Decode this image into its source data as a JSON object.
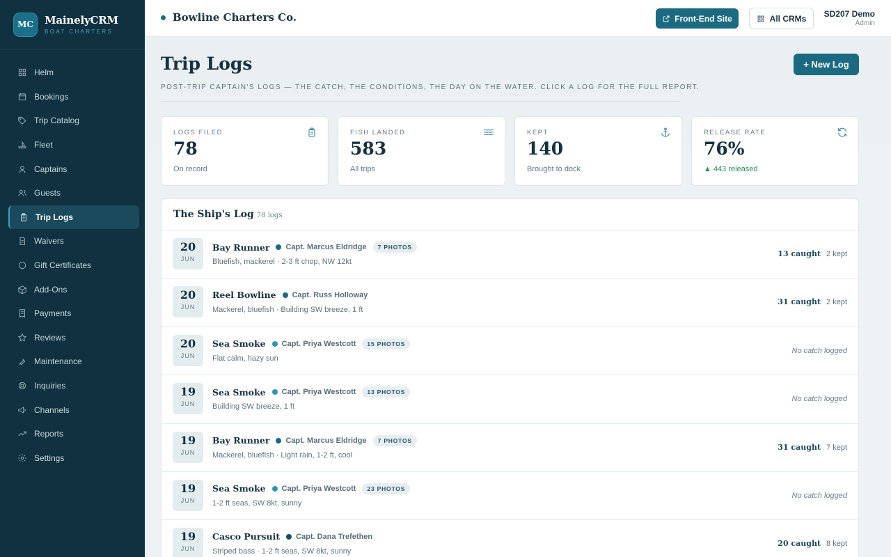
{
  "brand": {
    "initials": "MC",
    "name": "MainelyCRM",
    "subtitle": "BOAT CHARTERS"
  },
  "sidebar": {
    "items": [
      {
        "label": "Helm",
        "icon": "grid-icon",
        "active": false
      },
      {
        "label": "Bookings",
        "icon": "calendar-icon",
        "active": false
      },
      {
        "label": "Trip Catalog",
        "icon": "tag-icon",
        "active": false
      },
      {
        "label": "Fleet",
        "icon": "boat-icon",
        "active": false
      },
      {
        "label": "Captains",
        "icon": "captain-icon",
        "active": false
      },
      {
        "label": "Guests",
        "icon": "users-icon",
        "active": false
      },
      {
        "label": "Trip Logs",
        "icon": "clipboard-icon",
        "active": true
      },
      {
        "label": "Waivers",
        "icon": "document-icon",
        "active": false
      },
      {
        "label": "Gift Certificates",
        "icon": "circle-icon",
        "active": false
      },
      {
        "label": "Add-Ons",
        "icon": "box-icon",
        "active": false
      },
      {
        "label": "Payments",
        "icon": "receipt-icon",
        "active": false
      },
      {
        "label": "Reviews",
        "icon": "star-icon",
        "active": false
      },
      {
        "label": "Maintenance",
        "icon": "wrench-icon",
        "active": false
      },
      {
        "label": "Inquiries",
        "icon": "lifebuoy-icon",
        "active": false
      },
      {
        "label": "Channels",
        "icon": "megaphone-icon",
        "active": false
      },
      {
        "label": "Reports",
        "icon": "trend-icon",
        "active": false
      },
      {
        "label": "Settings",
        "icon": "gear-icon",
        "active": false
      }
    ]
  },
  "topbar": {
    "company": "Bowline Charters Co.",
    "front_end_label": "Front-End Site",
    "all_crms_label": "All CRMs",
    "user_name": "SD207 Demo",
    "user_role": "Admin"
  },
  "page": {
    "title": "Trip Logs",
    "subtitle": "POST-TRIP CAPTAIN'S LOGS — THE CATCH, THE CONDITIONS, THE DAY ON THE WATER. CLICK A LOG FOR THE FULL REPORT.",
    "new_log_label": "+ New Log"
  },
  "stats": [
    {
      "label": "LOGS FILED",
      "value": "78",
      "sub": "On record",
      "icon": "clipboard-icon",
      "green": false
    },
    {
      "label": "FISH LANDED",
      "value": "583",
      "sub": "All trips",
      "icon": "waves-icon",
      "green": false
    },
    {
      "label": "KEPT",
      "value": "140",
      "sub": "Brought to dock",
      "icon": "anchor-icon",
      "green": false
    },
    {
      "label": "RELEASE RATE",
      "value": "76%",
      "sub": "▲ 443 released",
      "icon": "refresh-icon",
      "green": true
    }
  ],
  "log": {
    "title": "The Ship's Log",
    "count": "78 logs",
    "rows": [
      {
        "day": "20",
        "month": "JUN",
        "boat": "Bay Runner",
        "captain": "Capt. Marcus Eldridge",
        "captain_color": "#1b6a82",
        "photos": "7 PHOTOS",
        "conditions": "Bluefish, mackerel · 2-3 ft chop, NW 12kt",
        "caught": "13 caught",
        "kept": "2 kept",
        "no_catch": ""
      },
      {
        "day": "20",
        "month": "JUN",
        "boat": "Reel Bowline",
        "captain": "Capt. Russ Holloway",
        "captain_color": "#1b6a82",
        "photos": "",
        "conditions": "Mackerel, bluefish · Building SW breeze, 1 ft",
        "caught": "31 caught",
        "kept": "2 kept",
        "no_catch": ""
      },
      {
        "day": "20",
        "month": "JUN",
        "boat": "Sea Smoke",
        "captain": "Capt. Priya Westcott",
        "captain_color": "#2f97ad",
        "photos": "15 PHOTOS",
        "conditions": "Flat calm, hazy sun",
        "caught": "",
        "kept": "",
        "no_catch": "No catch logged"
      },
      {
        "day": "19",
        "month": "JUN",
        "boat": "Sea Smoke",
        "captain": "Capt. Priya Westcott",
        "captain_color": "#2f97ad",
        "photos": "13 PHOTOS",
        "conditions": "Building SW breeze, 1 ft",
        "caught": "",
        "kept": "",
        "no_catch": "No catch logged"
      },
      {
        "day": "19",
        "month": "JUN",
        "boat": "Bay Runner",
        "captain": "Capt. Marcus Eldridge",
        "captain_color": "#1b6a82",
        "photos": "7 PHOTOS",
        "conditions": "Mackerel, bluefish · Light rain, 1-2 ft, cool",
        "caught": "31 caught",
        "kept": "7 kept",
        "no_catch": ""
      },
      {
        "day": "19",
        "month": "JUN",
        "boat": "Sea Smoke",
        "captain": "Capt. Priya Westcott",
        "captain_color": "#2f97ad",
        "photos": "23 PHOTOS",
        "conditions": "1-2 ft seas, SW 8kt, sunny",
        "caught": "",
        "kept": "",
        "no_catch": "No catch logged"
      },
      {
        "day": "19",
        "month": "JUN",
        "boat": "Casco Pursuit",
        "captain": "Capt. Dana Trefethen",
        "captain_color": "#174e62",
        "photos": "",
        "conditions": "Striped bass · 1-2 ft seas, SW 8kt, sunny",
        "caught": "20 caught",
        "kept": "8 kept",
        "no_catch": ""
      }
    ]
  }
}
